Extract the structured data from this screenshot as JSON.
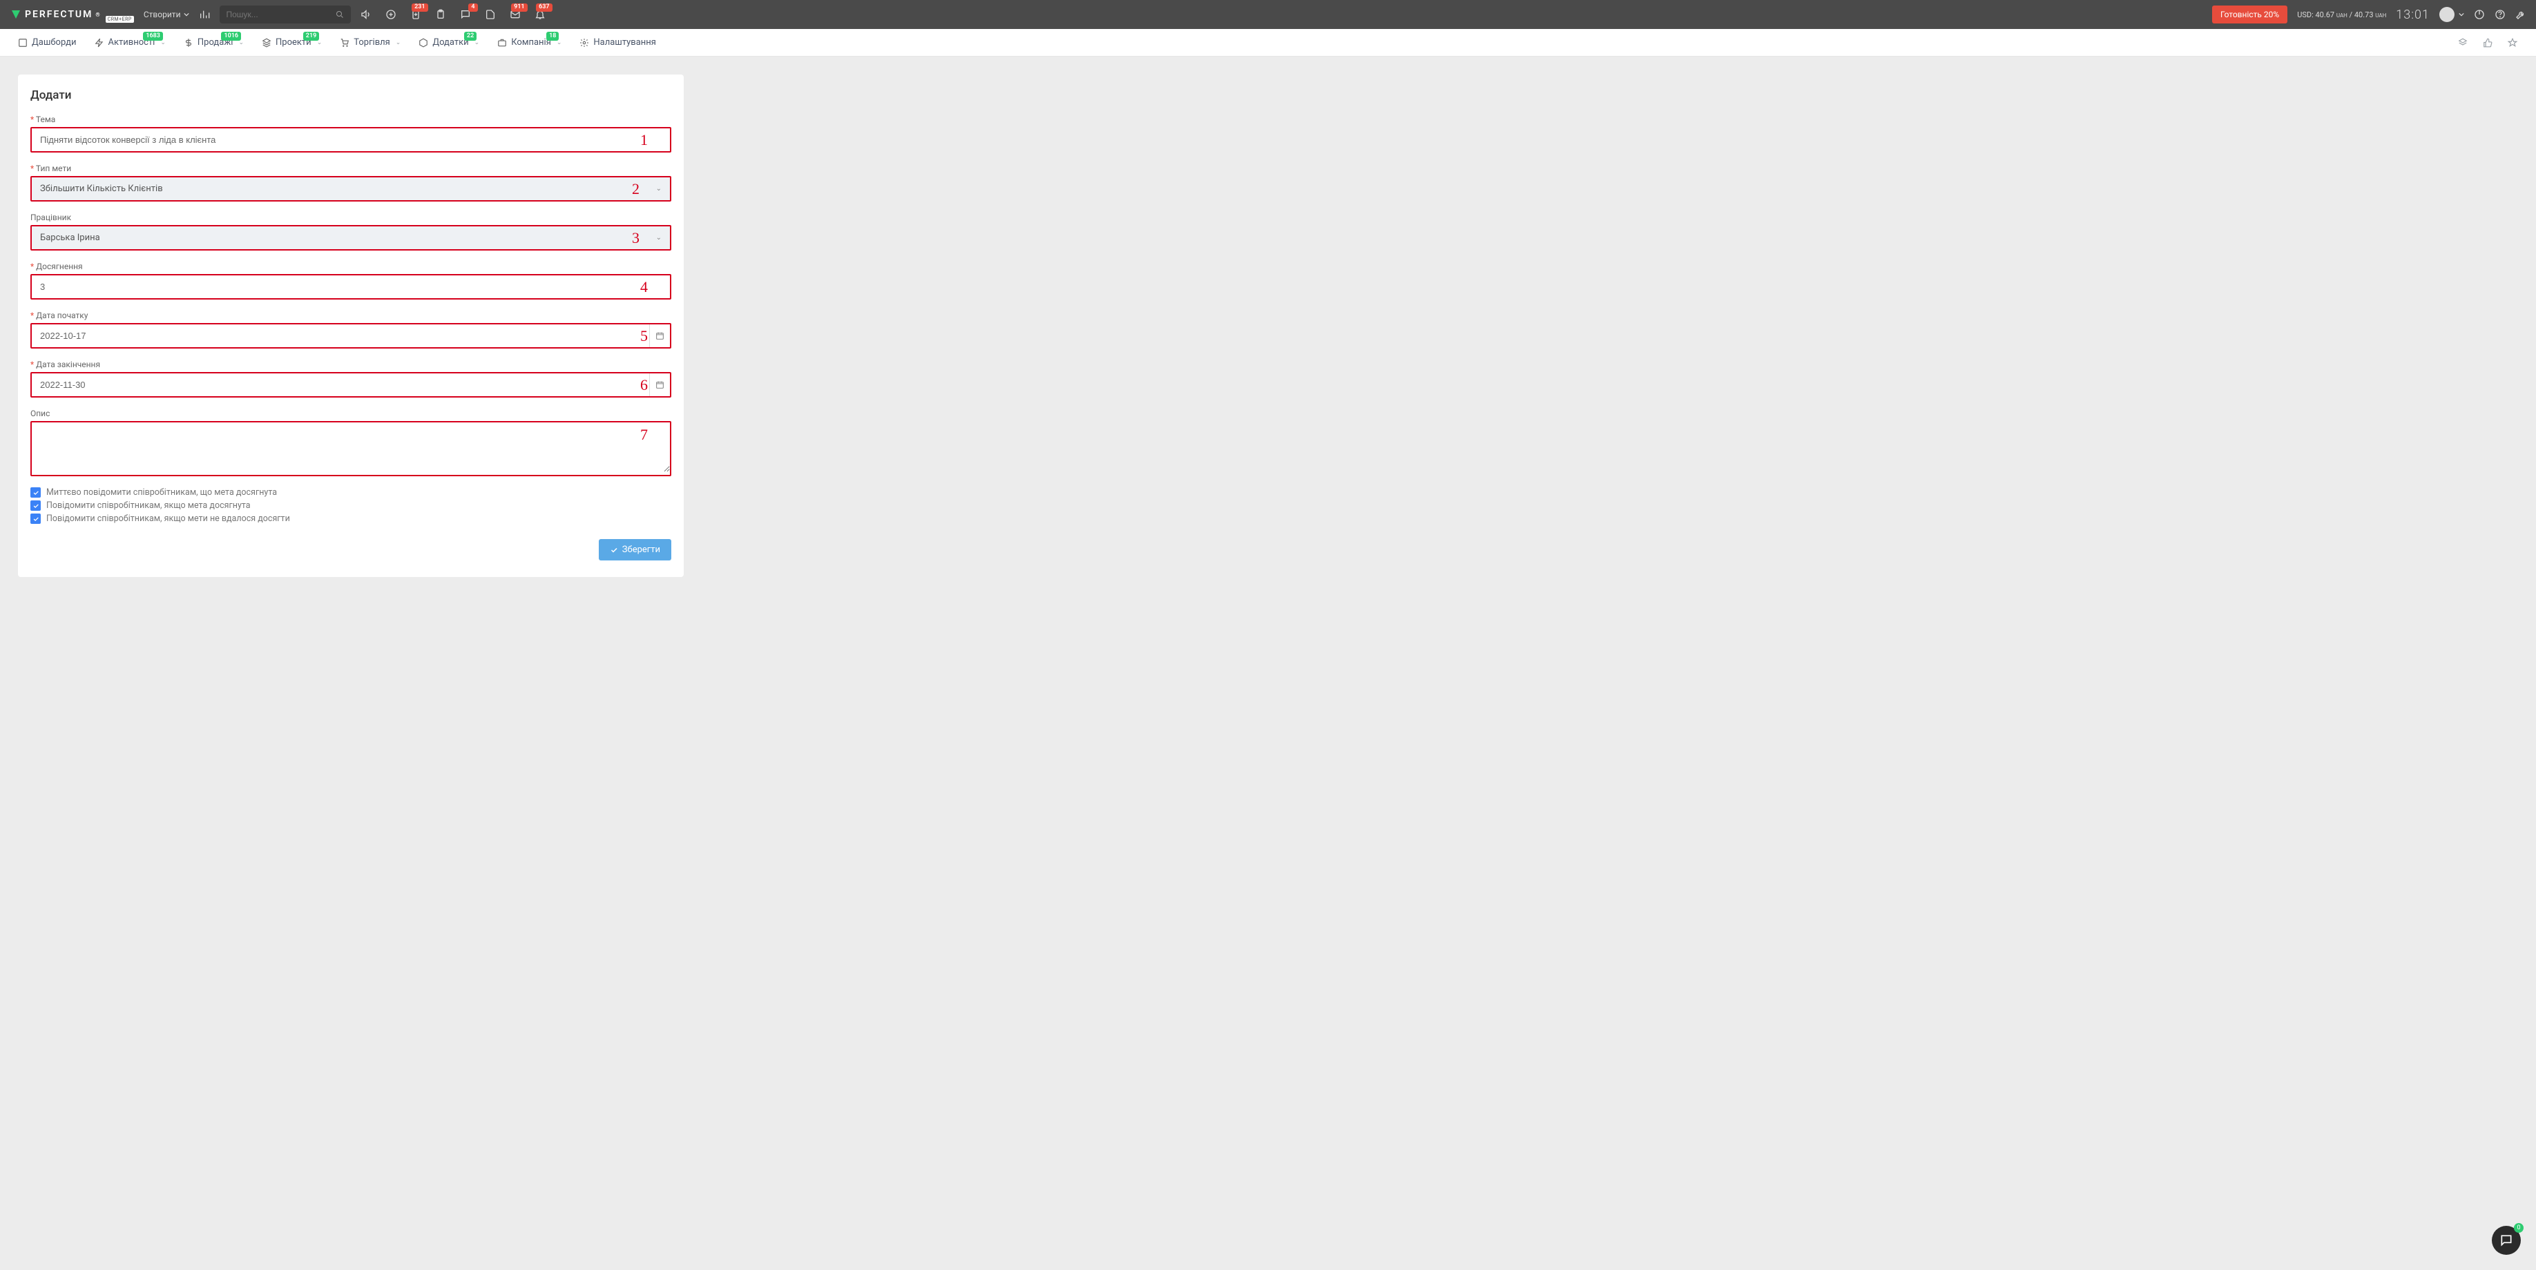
{
  "topbar": {
    "brand": "PERFECTUM",
    "brand_sub": "CRM+ERP",
    "create_label": "Створити",
    "search_placeholder": "Пошук...",
    "badges": {
      "doc1": "231",
      "msg": "4",
      "inbox": "911",
      "bell": "637"
    },
    "ready_label": "Готовність 20%",
    "fx_prefix": "USD: ",
    "fx_rate1": "40.67",
    "fx_sep": " / ",
    "fx_rate2": "40.73",
    "fx_ccy": "UAH",
    "clock": "13:01"
  },
  "nav": {
    "items": [
      {
        "label": "Дашборди",
        "badge": ""
      },
      {
        "label": "Активності",
        "badge": "1683"
      },
      {
        "label": "Продажі",
        "badge": "1016"
      },
      {
        "label": "Проекти",
        "badge": "219"
      },
      {
        "label": "Торгівля",
        "badge": ""
      },
      {
        "label": "Додатки",
        "badge": "22"
      },
      {
        "label": "Компанія",
        "badge": "18"
      },
      {
        "label": "Налаштування",
        "badge": ""
      }
    ]
  },
  "form": {
    "title": "Додати",
    "subject_label": "Тема",
    "subject_value": "Підняти відсоток конверсії з ліда в клієнта",
    "type_label": "Тип мети",
    "type_value": "Збільшити Кількість Клієнтів",
    "employee_label": "Працівник",
    "employee_value": "Барська Ірина",
    "achv_label": "Досягнення",
    "achv_value": "3",
    "start_label": "Дата початку",
    "start_value": "2022-10-17",
    "end_label": "Дата закінчення",
    "end_value": "2022-11-30",
    "desc_label": "Опис",
    "desc_value": "",
    "markers": {
      "m1": "1",
      "m2": "2",
      "m3": "3",
      "m4": "4",
      "m5": "5",
      "m6": "6",
      "m7": "7"
    },
    "chk1": "Миттєво повідомити співробітникам, що мета досягнута",
    "chk2": "Повідомити співробітникам, якщо мета досягнута",
    "chk3": "Повідомити співробітникам, якщо мети не вдалося досягти",
    "save_label": "Зберегти"
  },
  "fab": {
    "badge": "0"
  }
}
